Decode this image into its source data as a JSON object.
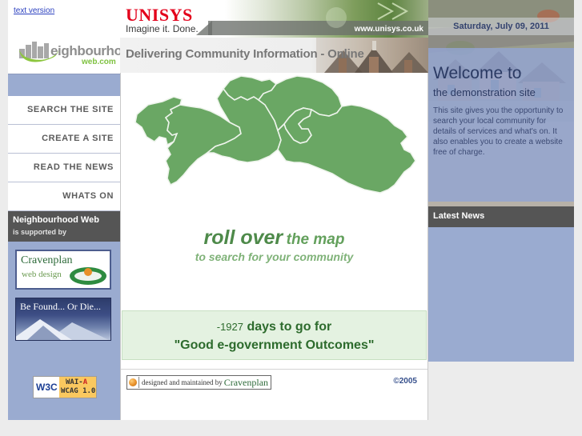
{
  "top": {
    "text_version_link": "text version"
  },
  "logo": {
    "word": "eighbourhood",
    "dotcom": "web.com"
  },
  "unisys": {
    "name": "UNISYS",
    "tagline": "Imagine it.  Done.",
    "url": "www.unisys.co.uk"
  },
  "banner": {
    "tagline": "Delivering Community Information - Online"
  },
  "nav": {
    "items": [
      {
        "label": "SEARCH THE SITE"
      },
      {
        "label": "CREATE A SITE"
      },
      {
        "label": "READ THE NEWS"
      },
      {
        "label": "WHATS ON"
      }
    ]
  },
  "support": {
    "title": "Neighbourhood Web",
    "subtitle": "is supported by"
  },
  "ads": {
    "cravenplan": {
      "name": "Cravenplan",
      "sub": "web design"
    },
    "be_found": {
      "text": "Be Found...  Or Die..."
    }
  },
  "w3c": {
    "logo": "W3C",
    "line1_pre": "WAI-",
    "line1_grade": "A",
    "line2": "WCAG 1.0"
  },
  "right": {
    "date": "Saturday, July 09, 2011",
    "welcome_title": "Welcome to",
    "welcome_sub": "the demonstration site",
    "welcome_body": "This site gives you the opportunity to search your local community for details of services and what's on. It also enables you to create a website free of charge.",
    "latest_news_label": "Latest News"
  },
  "main": {
    "rollover_bold": "roll over",
    "rollover_light": "the map",
    "rollover_sub": "to search for your community",
    "countdown": {
      "days": "-1927",
      "line1_rest": "days to go for",
      "line2": "\"Good e-government Outcomes\""
    }
  },
  "footer": {
    "credit_text": "designed and maintained by",
    "credit_brand": "Cravenplan",
    "copyright": "©2005"
  },
  "colors": {
    "accent_green": "#6aa764",
    "panel_blue": "#9aabd0",
    "dark_bar": "#555555",
    "unisys_red": "#e3001b",
    "link_blue": "#2a3fbf"
  }
}
